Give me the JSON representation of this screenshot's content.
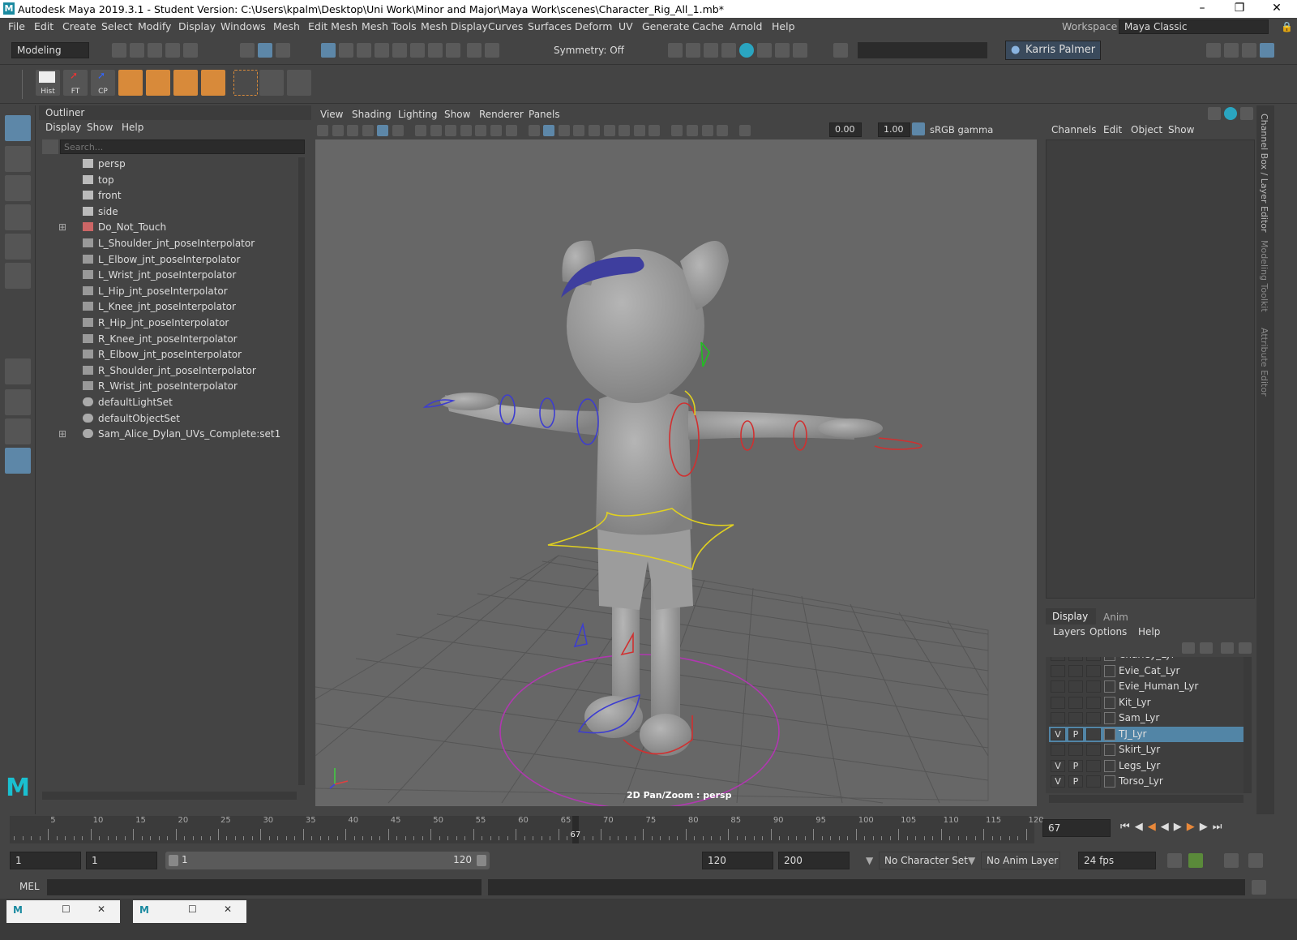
{
  "window": {
    "title": "Autodesk Maya 2019.3.1 - Student Version: C:\\Users\\kpalm\\Desktop\\Uni Work\\Minor and Major\\Maya Work\\scenes\\Character_Rig_All_1.mb*",
    "logo": "M"
  },
  "menubar": [
    "File",
    "Edit",
    "Create",
    "Select",
    "Modify",
    "Display",
    "Windows",
    "Mesh",
    "Edit Mesh",
    "Mesh Tools",
    "Mesh Display",
    "Curves",
    "Surfaces",
    "Deform",
    "UV",
    "Generate",
    "Cache",
    "Arnold",
    "Help"
  ],
  "workspace": {
    "label": "Workspace :",
    "value": "Maya Classic"
  },
  "statusline": {
    "menuset": "Modeling",
    "symmetry": "Symmetry: Off",
    "user": "Karris Palmer"
  },
  "shelf": {
    "hist": "Hist",
    "ft": "FT",
    "cp": "CP"
  },
  "outliner": {
    "title": "Outliner",
    "menus": [
      "Display",
      "Show",
      "Help"
    ],
    "search_placeholder": "Search...",
    "items": [
      {
        "label": "persp",
        "icon": "camera-icon"
      },
      {
        "label": "top",
        "icon": "camera-icon"
      },
      {
        "label": "front",
        "icon": "camera-icon"
      },
      {
        "label": "side",
        "icon": "camera-icon"
      },
      {
        "label": "Do_Not_Touch",
        "icon": "group-icon",
        "expand": true
      },
      {
        "label": "L_Shoulder_jnt_poseInterpolator",
        "icon": "pose-icon"
      },
      {
        "label": "L_Elbow_jnt_poseInterpolator",
        "icon": "pose-icon"
      },
      {
        "label": "L_Wrist_jnt_poseInterpolator",
        "icon": "pose-icon"
      },
      {
        "label": "L_Hip_jnt_poseInterpolator",
        "icon": "pose-icon"
      },
      {
        "label": "L_Knee_jnt_poseInterpolator",
        "icon": "pose-icon"
      },
      {
        "label": "R_Hip_jnt_poseInterpolator",
        "icon": "pose-icon"
      },
      {
        "label": "R_Knee_jnt_poseInterpolator",
        "icon": "pose-icon"
      },
      {
        "label": "R_Elbow_jnt_poseInterpolator",
        "icon": "pose-icon"
      },
      {
        "label": "R_Shoulder_jnt_poseInterpolator",
        "icon": "pose-icon"
      },
      {
        "label": "R_Wrist_jnt_poseInterpolator",
        "icon": "pose-icon"
      },
      {
        "label": "defaultLightSet",
        "icon": "set-icon"
      },
      {
        "label": "defaultObjectSet",
        "icon": "set-icon"
      },
      {
        "label": "Sam_Alice_Dylan_UVs_Complete:set1",
        "icon": "set-icon",
        "expand": true
      }
    ]
  },
  "viewport": {
    "menus": [
      "View",
      "Shading",
      "Lighting",
      "Show",
      "Renderer",
      "Panels"
    ],
    "exposure": "0.00",
    "gamma": "1.00",
    "colorspace": "sRGB gamma",
    "hud": "2D Pan/Zoom : persp"
  },
  "channelbox": {
    "menus": [
      "Channels",
      "Edit",
      "Object",
      "Show"
    ]
  },
  "layereditor": {
    "tabs": [
      "Display",
      "Anim"
    ],
    "menus": [
      "Layers",
      "Options",
      "Help"
    ],
    "layers": [
      {
        "name": "Charley_Lyr",
        "v": "",
        "p": "",
        "selected": false
      },
      {
        "name": "Evie_Cat_Lyr",
        "v": "",
        "p": "",
        "selected": false
      },
      {
        "name": "Evie_Human_Lyr",
        "v": "",
        "p": "",
        "selected": false
      },
      {
        "name": "Kit_Lyr",
        "v": "",
        "p": "",
        "selected": false
      },
      {
        "name": "Sam_Lyr",
        "v": "",
        "p": "",
        "selected": false
      },
      {
        "name": "TJ_Lyr",
        "v": "V",
        "p": "P",
        "selected": true
      },
      {
        "name": "Skirt_Lyr",
        "v": "",
        "p": "",
        "selected": false
      },
      {
        "name": "Legs_Lyr",
        "v": "V",
        "p": "P",
        "selected": false
      },
      {
        "name": "Torso_Lyr",
        "v": "V",
        "p": "P",
        "selected": false
      }
    ]
  },
  "sidetabs": [
    "Channel Box / Layer Editor",
    "Modeling Toolkit",
    "Attribute Editor"
  ],
  "timeline": {
    "ticks": [
      "5",
      "10",
      "15",
      "20",
      "25",
      "30",
      "35",
      "40",
      "45",
      "50",
      "55",
      "60",
      "65",
      "70",
      "75",
      "80",
      "85",
      "90",
      "95",
      "100",
      "105",
      "110",
      "115",
      "120"
    ],
    "current": "67",
    "current_field": "67"
  },
  "range": {
    "start": "1",
    "anim_start": "1",
    "slider_start": "1",
    "slider_end": "120",
    "end": "120",
    "anim_end": "200",
    "character_set": "No Character Set",
    "anim_layer": "No Anim Layer",
    "fps": "24 fps"
  },
  "cmdline": {
    "label": "MEL"
  }
}
